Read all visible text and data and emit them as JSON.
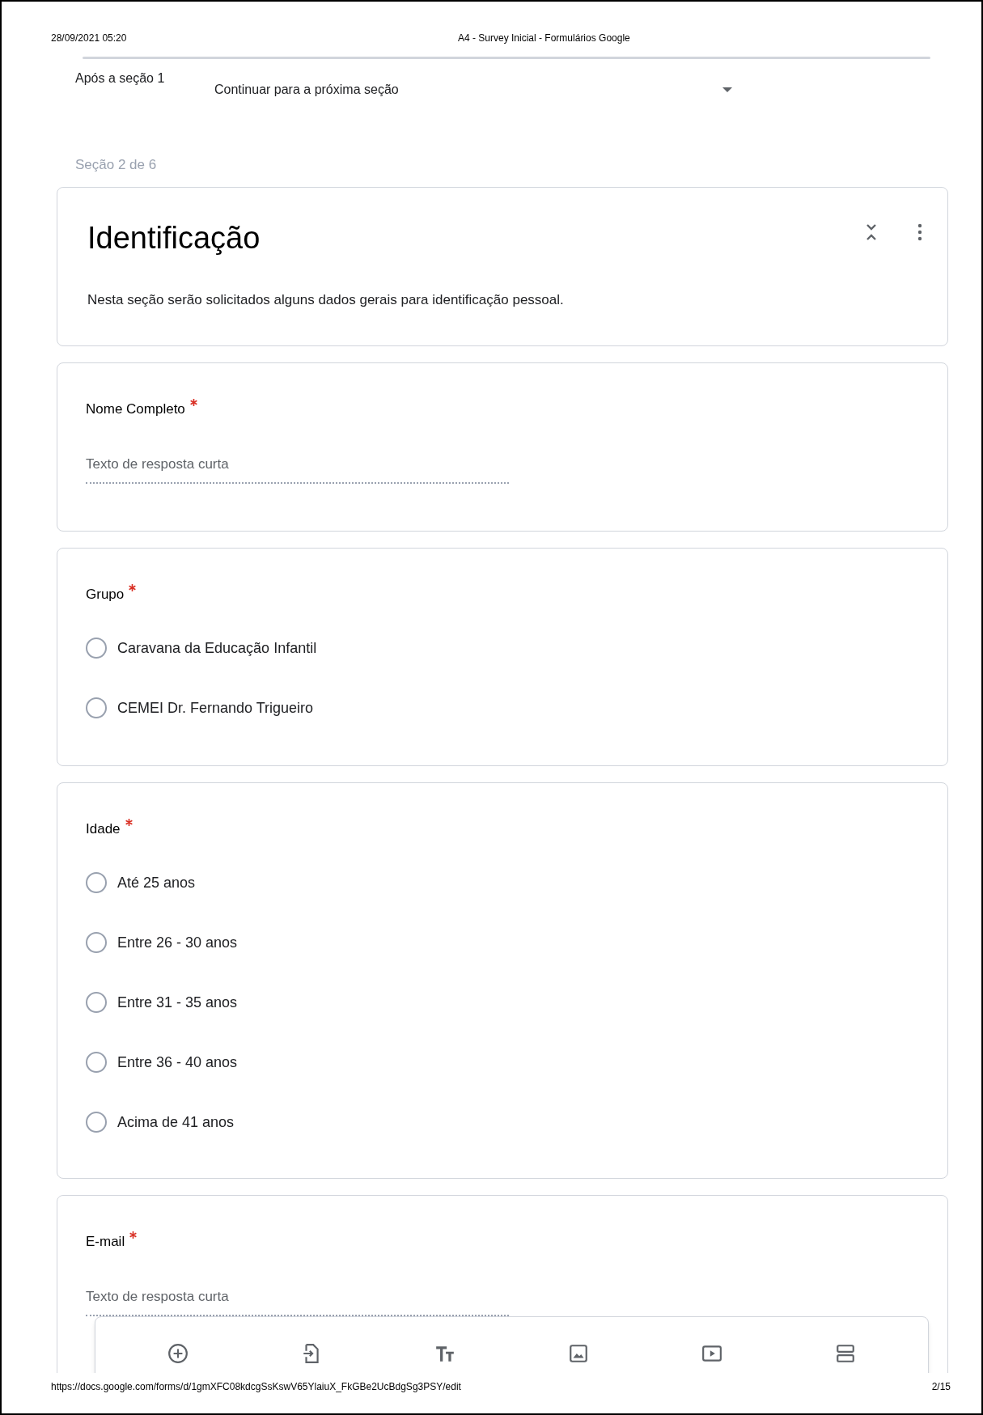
{
  "header": {
    "date": "28/09/2021 05:20",
    "title": "A4 - Survey Inicial - Formulários Google"
  },
  "after_section": {
    "label": "Após a seção 1",
    "value": "Continuar para a próxima seção"
  },
  "section_counter": "Seção 2 de 6",
  "section": {
    "title": "Identificação",
    "description": "Nesta seção serão solicitados alguns dados gerais para identificação pessoal."
  },
  "questions": [
    {
      "kind": "short",
      "title": "Nome Completo",
      "required": true,
      "placeholder": "Texto de resposta curta"
    },
    {
      "kind": "choice",
      "title": "Grupo",
      "required": true,
      "options": [
        {
          "label": "Caravana da Educação Infantil",
          "selected": false
        },
        {
          "label": "CEMEI Dr. Fernando Trigueiro",
          "selected": false
        }
      ]
    },
    {
      "kind": "choice",
      "title": "Idade",
      "required": true,
      "options": [
        {
          "label": "Até 25 anos",
          "selected": false
        },
        {
          "label": "Entre 26 - 30 anos",
          "selected": false
        },
        {
          "label": "Entre 31 - 35 anos",
          "selected": false
        },
        {
          "label": "Entre 36 - 40 anos",
          "selected": false
        },
        {
          "label": "Acima de 41 anos",
          "selected": false
        }
      ]
    },
    {
      "kind": "short",
      "title": "E-mail",
      "required": true,
      "placeholder": "Texto de resposta curta"
    }
  ],
  "footer": {
    "url": "https://docs.google.com/forms/d/1gmXFC08kdcgSsKswV65YlaiuX_FkGBe2UcBdgSg3PSY/edit",
    "page": "2/15"
  }
}
